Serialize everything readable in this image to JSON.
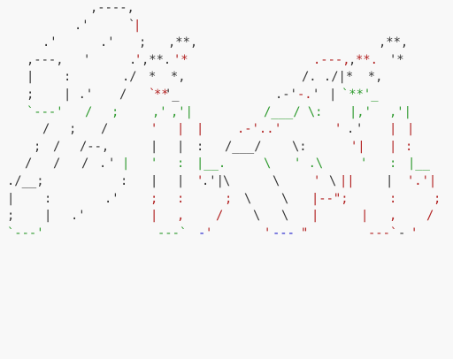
{
  "colors": {
    "k": "#333333",
    "r": "#b22222",
    "g": "#2e9a2e",
    "b": "#2020cc"
  },
  "rows": [
    [
      [
        102,
        "k",
        ",----,"
      ]
    ],
    [
      [
        84,
        "k",
        ".'"
      ],
      [
        145,
        "k",
        "`"
      ],
      [
        151,
        "r",
        "|"
      ]
    ],
    [
      [
        48,
        "k",
        ".'"
      ],
      [
        113,
        "k",
        ".'"
      ],
      [
        157,
        "k",
        ";"
      ],
      [
        190,
        "k",
        ",**,"
      ],
      [
        428,
        "k",
        ",**,"
      ]
    ],
    [
      [
        30,
        "k",
        ",---,"
      ],
      [
        94,
        "k",
        "'"
      ],
      [
        146,
        "k",
        "."
      ],
      [
        152,
        "r",
        "'"
      ],
      [
        160,
        "k",
        ",**."
      ],
      [
        196,
        "r",
        "'*"
      ],
      [
        354,
        "r",
        ".---,"
      ],
      [
        394,
        "k",
        ","
      ],
      [
        402,
        "r",
        "**."
      ],
      [
        440,
        "k",
        "'*"
      ]
    ],
    [
      [
        30,
        "k",
        "|"
      ],
      [
        72,
        "k",
        ":"
      ],
      [
        138,
        "k",
        "./"
      ],
      [
        168,
        "k",
        "*  *,"
      ],
      [
        341,
        "k",
        "/. ./|*  *,"
      ]
    ],
    [
      [
        30,
        "k",
        ";"
      ],
      [
        72,
        "k",
        "| .'"
      ],
      [
        135,
        "k",
        "/"
      ],
      [
        168,
        "r",
        "`"
      ],
      [
        174,
        "r",
        "**"
      ],
      [
        186,
        "k",
        "'_"
      ],
      [
        311,
        "k",
        ".-'"
      ],
      [
        336,
        "r",
        "-."
      ],
      [
        353,
        "k",
        "'"
      ],
      [
        372,
        "k",
        "|"
      ],
      [
        386,
        "g",
        "`**'_"
      ]
    ],
    [
      [
        30,
        "g",
        "`---'"
      ],
      [
        96,
        "g",
        "/"
      ],
      [
        126,
        "g",
        ";"
      ],
      [
        172,
        "g",
        ",'"
      ],
      [
        193,
        "g",
        ",'|"
      ],
      [
        298,
        "g",
        "/___/ \\:"
      ],
      [
        395,
        "g",
        "|,'"
      ],
      [
        440,
        "g",
        ",'|"
      ]
    ],
    [
      [
        48,
        "k",
        "/"
      ],
      [
        78,
        "k",
        ";"
      ],
      [
        114,
        "k",
        "/"
      ],
      [
        170,
        "r",
        "'"
      ],
      [
        200,
        "r",
        "|"
      ],
      [
        222,
        "r",
        "|"
      ],
      [
        268,
        "r",
        ".-'.."
      ],
      [
        310,
        "r",
        "'"
      ],
      [
        378,
        "r",
        "'"
      ],
      [
        392,
        "k",
        "."
      ],
      [
        402,
        "k",
        "'"
      ],
      [
        440,
        "r",
        "|"
      ],
      [
        460,
        "r",
        "|"
      ]
    ],
    [
      [
        38,
        "k",
        ";"
      ],
      [
        60,
        "k",
        "/"
      ],
      [
        90,
        "k",
        "/--,"
      ],
      [
        170,
        "k",
        "|"
      ],
      [
        200,
        "k",
        "|"
      ],
      [
        222,
        "k",
        ":"
      ],
      [
        254,
        "k",
        "/___/"
      ],
      [
        330,
        "k",
        "\\:"
      ],
      [
        396,
        "r",
        "'|"
      ],
      [
        440,
        "r",
        "|"
      ],
      [
        458,
        "r",
        ":"
      ]
    ],
    [
      [
        28,
        "k",
        "/"
      ],
      [
        60,
        "k",
        "/"
      ],
      [
        92,
        "k",
        "/"
      ],
      [
        112,
        "k",
        "."
      ],
      [
        122,
        "k",
        "'"
      ],
      [
        138,
        "g",
        "|"
      ],
      [
        170,
        "g",
        "'"
      ],
      [
        200,
        "g",
        ":"
      ],
      [
        222,
        "g",
        "|__."
      ],
      [
        298,
        "g",
        "\\"
      ],
      [
        332,
        "g",
        "' .\\"
      ],
      [
        407,
        "g",
        "'"
      ],
      [
        440,
        "g",
        ":"
      ],
      [
        461,
        "g",
        "|__"
      ]
    ],
    [
      [
        8,
        "k",
        "./__;"
      ],
      [
        136,
        "k",
        ":"
      ],
      [
        170,
        "k",
        "|"
      ],
      [
        200,
        "k",
        "|"
      ],
      [
        222,
        "r",
        "'"
      ],
      [
        228,
        "k",
        ".'|"
      ],
      [
        252,
        "k",
        "\\"
      ],
      [
        308,
        "k",
        "\\"
      ],
      [
        354,
        "r",
        "'"
      ],
      [
        372,
        "k",
        "\\"
      ],
      [
        384,
        "r",
        "||"
      ],
      [
        436,
        "k",
        "|"
      ],
      [
        460,
        "r",
        "'.'|"
      ]
    ],
    [
      [
        8,
        "k",
        "|"
      ],
      [
        50,
        "k",
        ":"
      ],
      [
        118,
        "k",
        ".'"
      ],
      [
        170,
        "r",
        ";"
      ],
      [
        200,
        "r",
        ":"
      ],
      [
        254,
        "r",
        ";"
      ],
      [
        276,
        "k",
        "\\"
      ],
      [
        318,
        "k",
        "\\"
      ],
      [
        352,
        "r",
        "|--\";"
      ],
      [
        440,
        "r",
        ":"
      ],
      [
        490,
        "r",
        ";"
      ]
    ],
    [
      [
        8,
        "k",
        ";"
      ],
      [
        50,
        "k",
        "|"
      ],
      [
        80,
        "k",
        ".'"
      ],
      [
        170,
        "r",
        "|"
      ],
      [
        200,
        "r",
        ","
      ],
      [
        244,
        "r",
        "/"
      ],
      [
        286,
        "k",
        "\\"
      ],
      [
        318,
        "k",
        "\\"
      ],
      [
        352,
        "r",
        "|"
      ],
      [
        408,
        "r",
        "|"
      ],
      [
        440,
        "r",
        ","
      ],
      [
        482,
        "r",
        "/"
      ]
    ],
    [
      [
        8,
        "g",
        "`---'"
      ],
      [
        178,
        "g",
        "---`"
      ],
      [
        224,
        "b",
        "-"
      ],
      [
        232,
        "r",
        "'"
      ],
      [
        298,
        "r",
        "'"
      ],
      [
        308,
        "b",
        "---"
      ],
      [
        340,
        "r",
        "\""
      ],
      [
        416,
        "r",
        "---`"
      ],
      [
        450,
        "k",
        "-"
      ],
      [
        464,
        "r",
        "'"
      ]
    ]
  ]
}
